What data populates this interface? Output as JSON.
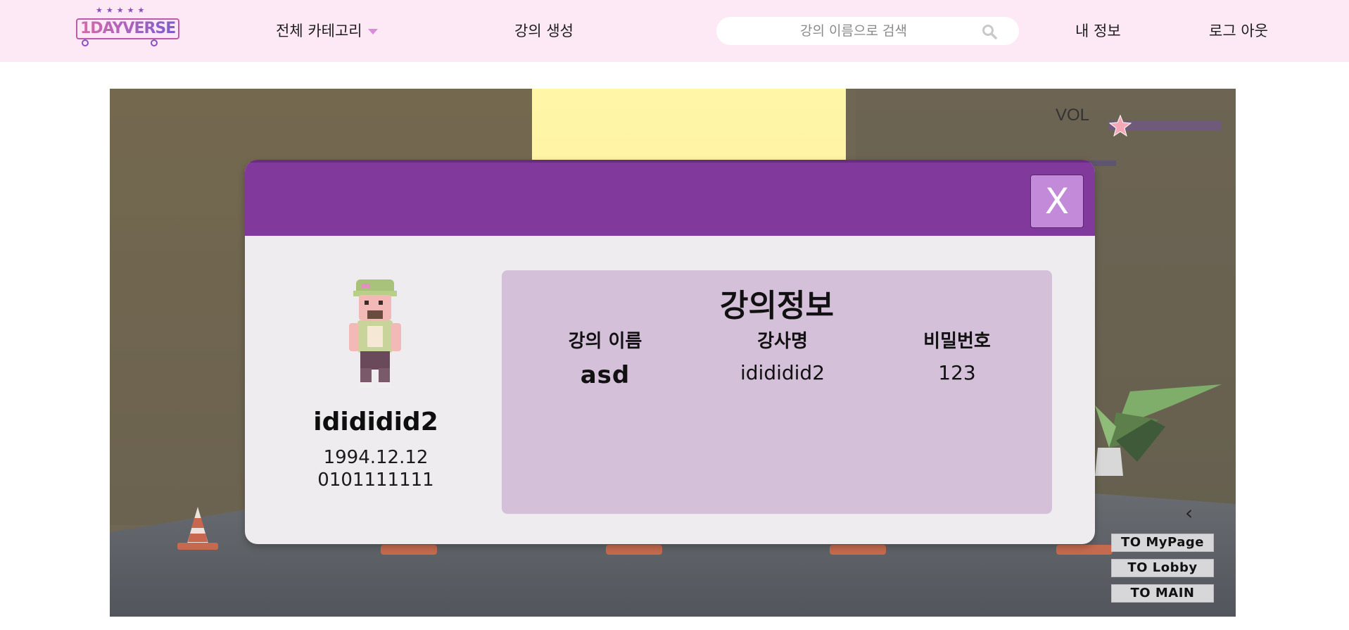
{
  "nav": {
    "logo_text": "1DAYVERSE",
    "category_label": "전체 카테고리",
    "create_lecture_label": "강의 생성",
    "search_placeholder": "강의 이름으로 검색",
    "my_info_label": "내 정보",
    "logout_label": "로그 아웃"
  },
  "game": {
    "vol_label": "VOL",
    "vol_level": 0.1,
    "buttons": {
      "to_mypage": "TO MyPage",
      "to_lobby": "TO Lobby",
      "to_main": "TO MAIN"
    }
  },
  "modal": {
    "close_label": "X",
    "user": {
      "name": "idididid2",
      "birth": "1994.12.12",
      "phone": "0101111111"
    },
    "info": {
      "title": "강의정보",
      "columns": [
        {
          "header": "강의 이름",
          "value": "asd"
        },
        {
          "header": "강사명",
          "value": "idididid2"
        },
        {
          "header": "비밀번호",
          "value": "123"
        }
      ]
    }
  },
  "colors": {
    "nav_bg": "#fde8f5",
    "modal_header": "#82399c",
    "info_panel": "#d5c0da",
    "close_button": "#c28ad8"
  }
}
